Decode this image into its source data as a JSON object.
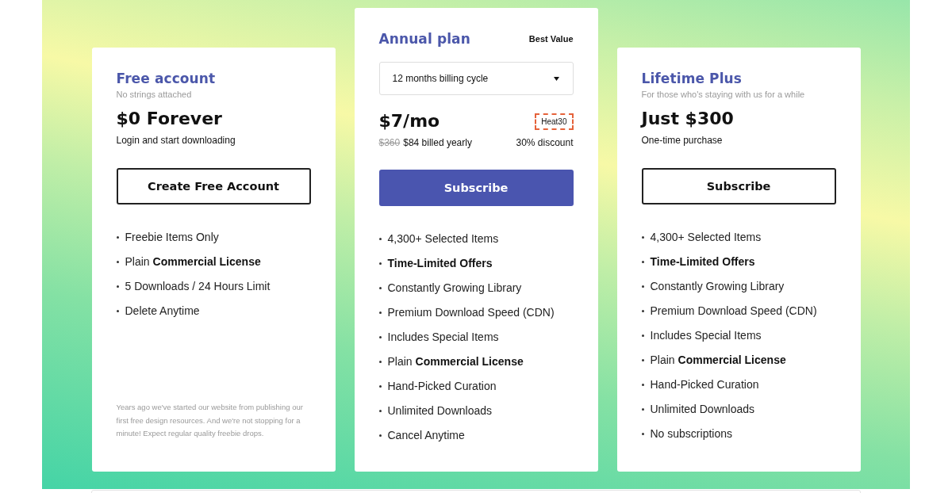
{
  "plans": [
    {
      "kind": "standard",
      "title": "Free account",
      "subtitle": "No strings attached",
      "price": "$0 Forever",
      "price_note": "Login and start downloading",
      "button": {
        "label": "Create Free Account",
        "kind": "outline"
      },
      "features": [
        {
          "text": "Freebie Items Only",
          "bold": false
        },
        {
          "text": "Plain **Commercial License**",
          "bold": false
        },
        {
          "text": "5 Downloads / 24 Hours Limit",
          "bold": false
        },
        {
          "text": "Delete Anytime",
          "bold": false
        }
      ],
      "note": "Years ago we've started our website from publishing our first free design resources. And we're not stopping for a minute! Expect regular quality freebie drops."
    },
    {
      "kind": "featured",
      "title": "Annual plan",
      "badge": "Best Value",
      "billing_select": {
        "value": "12 months billing cycle"
      },
      "price": "$7/mo",
      "coupon": "Heat30",
      "old_price": "$360",
      "price_note": "$84 billed yearly",
      "discount": "30% discount",
      "button": {
        "label": "Subscribe",
        "kind": "filled"
      },
      "features": [
        {
          "text": "4,300+ Selected Items",
          "bold": false
        },
        {
          "text": "Time-Limited Offers",
          "bold": true
        },
        {
          "text": "Constantly Growing Library",
          "bold": false
        },
        {
          "text": "Premium Download Speed (CDN)",
          "bold": false
        },
        {
          "text": "Includes Special Items",
          "bold": false
        },
        {
          "text": "Plain **Commercial License**",
          "bold": false
        },
        {
          "text": "Hand-Picked Curation",
          "bold": false
        },
        {
          "text": "Unlimited Downloads",
          "bold": false
        },
        {
          "text": "Cancel Anytime",
          "bold": false
        }
      ]
    },
    {
      "kind": "standard",
      "title": "Lifetime Plus",
      "subtitle": "For those who's staying with us for a while",
      "price": "Just $300",
      "price_note": "One-time purchase",
      "button": {
        "label": "Subscribe",
        "kind": "outline"
      },
      "features": [
        {
          "text": "4,300+ Selected Items",
          "bold": false
        },
        {
          "text": "Time-Limited Offers",
          "bold": true
        },
        {
          "text": "Constantly Growing Library",
          "bold": false
        },
        {
          "text": "Premium Download Speed (CDN)",
          "bold": false
        },
        {
          "text": "Includes Special Items",
          "bold": false
        },
        {
          "text": "Plain **Commercial License**",
          "bold": false
        },
        {
          "text": "Hand-Picked Curation",
          "bold": false
        },
        {
          "text": "Unlimited Downloads",
          "bold": false
        },
        {
          "text": "No subscriptions",
          "bold": false
        }
      ]
    }
  ]
}
